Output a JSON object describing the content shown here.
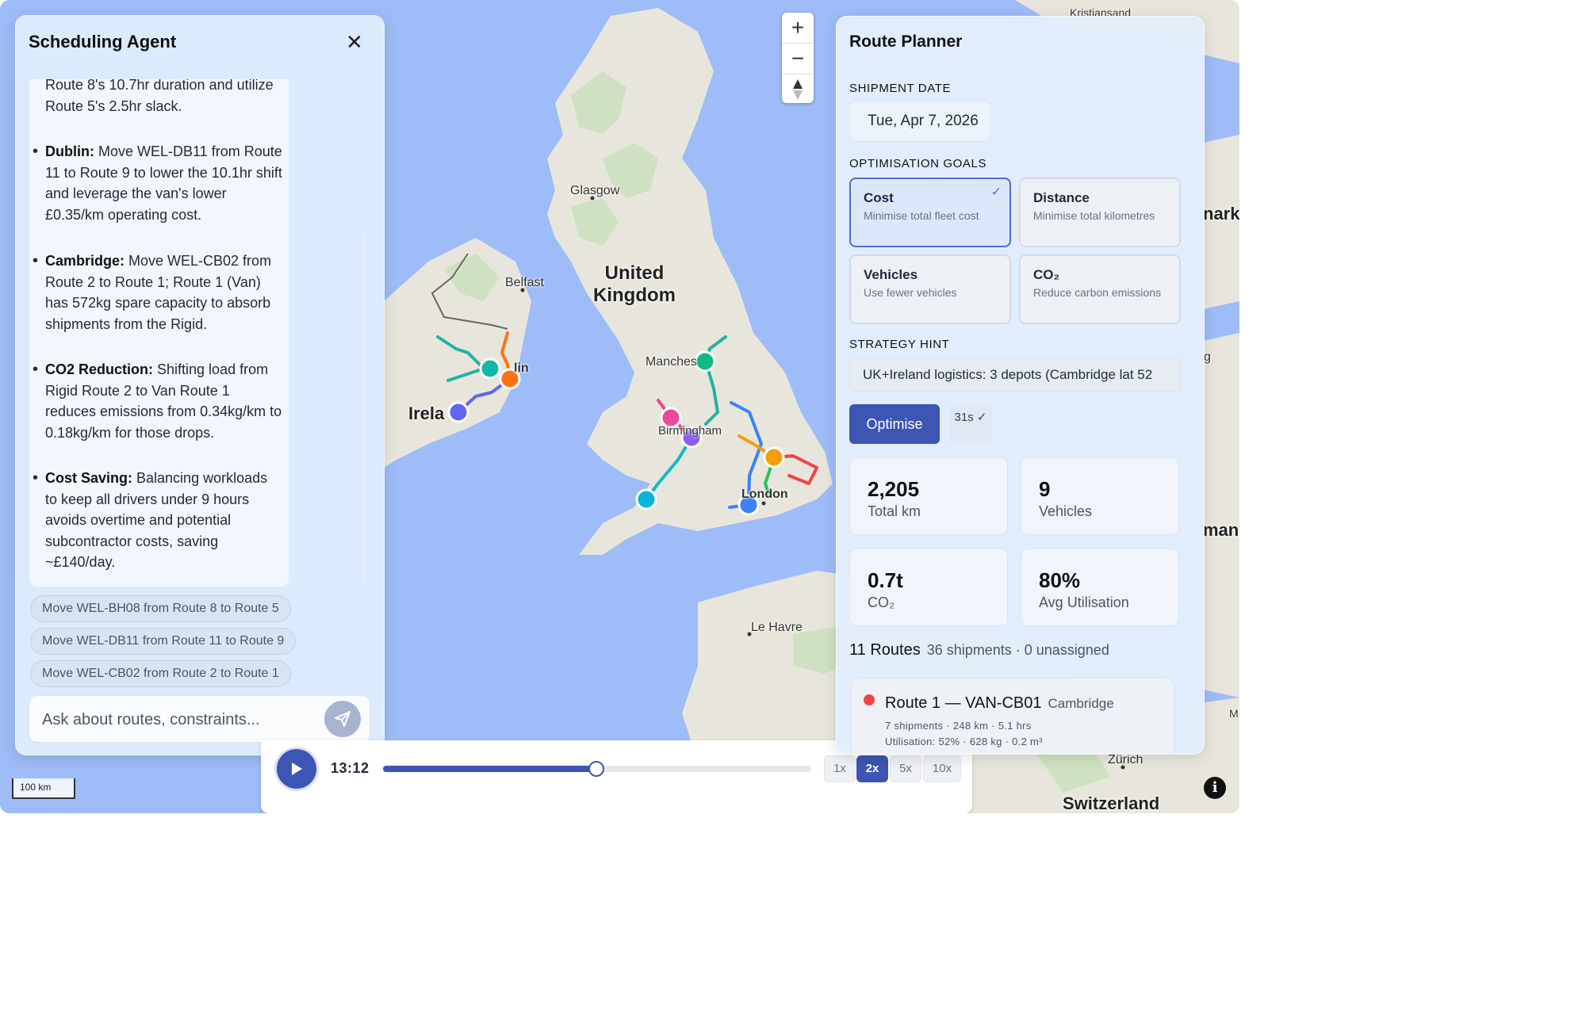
{
  "agent": {
    "title": "Scheduling Agent",
    "close_icon": "close-icon",
    "intro": "Route 8's 10.7hr duration and utilize Route 5's 2.5hr slack.",
    "bullets": [
      {
        "head": "Dublin:",
        "text": " Move WEL-DB11 from Route 11 to Route 9 to lower the 10.1hr shift and leverage the van's lower £0.35/km operating cost."
      },
      {
        "head": "Cambridge:",
        "text": " Move WEL-CB02 from Route 2 to Route 1; Route 1 (Van) has 572kg spare capacity to absorb shipments from the Rigid."
      },
      {
        "head": "CO2 Reduction:",
        "text": " Shifting load from Rigid Route 2 to Van Route 1 reduces emissions from 0.34kg/km to 0.18kg/km for those drops."
      },
      {
        "head": "Cost Saving:",
        "text": " Balancing workloads to keep all drivers under 9 hours avoids overtime and potential subcontractor costs, saving ~£140/day."
      }
    ],
    "suggestions": [
      "Move WEL-BH08 from Route 8 to Route 5",
      "Move WEL-DB11 from Route 11 to Route 9",
      "Move WEL-CB02 from Route 2 to Route 1"
    ],
    "input_placeholder": "Ask about routes, constraints...",
    "send_icon": "send-icon"
  },
  "map": {
    "zoom_in": "+",
    "zoom_out": "−",
    "compass_icon": "compass-icon",
    "places": {
      "glasgow": "Glasgow",
      "belfast": "Belfast",
      "uk_line1": "United",
      "uk_line2": "Kingdom",
      "manchester": "Manches",
      "birmingham": "Birmingham",
      "dublin": "lin",
      "ireland": "Irela",
      "london": "London",
      "le_havre": "Le Havre",
      "zurich": "Zürich",
      "switzerland": "Switzerland",
      "denmark_part": "nark",
      "germany_part": "many",
      "kristiansand": "Kristiansand",
      "edge_g": "g",
      "edge_m": "M"
    },
    "scale": "100 km",
    "info_icon": "info-icon",
    "colors": {
      "water": "#9ebcf7",
      "land": "#e8e6dc",
      "forest": "#cfe1c1"
    }
  },
  "timeline": {
    "play_icon": "play-icon",
    "time": "13:12",
    "progress": 0.497,
    "speeds": [
      "1x",
      "2x",
      "5x",
      "10x"
    ],
    "active_speed": "2x"
  },
  "planner": {
    "title": "Route Planner",
    "shipment_date_label": "SHIPMENT DATE",
    "shipment_date": "Tue, Apr 7, 2026",
    "goals_label": "OPTIMISATION GOALS",
    "goals": [
      {
        "title": "Cost",
        "desc": "Minimise total fleet cost",
        "selected": true
      },
      {
        "title": "Distance",
        "desc": "Minimise total kilometres",
        "selected": false
      },
      {
        "title": "Vehicles",
        "desc": "Use fewer vehicles",
        "selected": false
      },
      {
        "title": "CO₂",
        "desc": "Reduce carbon emissions",
        "selected": false
      }
    ],
    "strategy_label": "STRATEGY HINT",
    "strategy_value": "UK+Ireland logistics: 3 depots (Cambridge lat 52",
    "optimise_label": "Optimise",
    "timer": "31s ✓",
    "stats": [
      {
        "value": "2,205",
        "label": "Total km"
      },
      {
        "value": "9",
        "label": "Vehicles"
      },
      {
        "value": "0.7t",
        "label": "CO₂"
      },
      {
        "value": "80%",
        "label": "Avg Utilisation"
      }
    ],
    "routes_title": "11 Routes",
    "routes_sub": "36 shipments · 0 unassigned",
    "first_route": {
      "color": "#ef4444",
      "title": "Route 1 — VAN-CB01",
      "depot": "Cambridge",
      "meta": "7 shipments · 248 km · 5.1 hrs",
      "util": "Utilisation: 52% · 628 kg · 0.2 m³"
    }
  }
}
